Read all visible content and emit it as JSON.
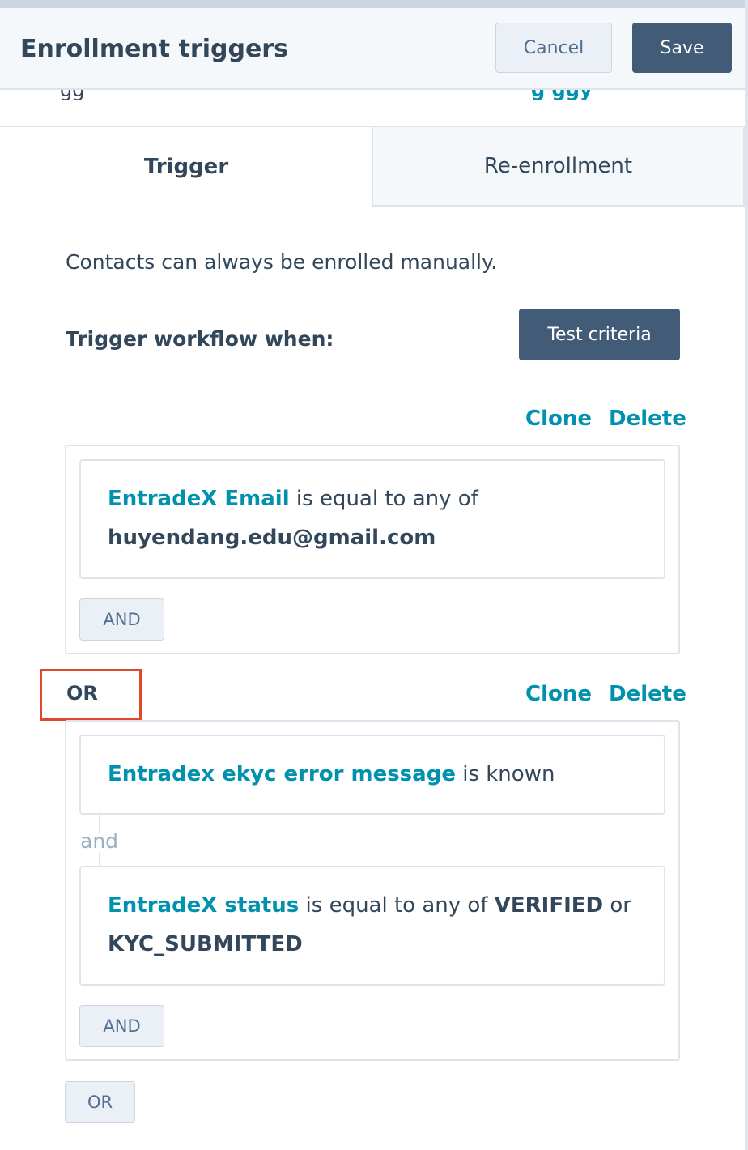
{
  "header": {
    "title": "Enrollment triggers",
    "cancel_label": "Cancel",
    "save_label": "Save"
  },
  "tabs": [
    {
      "label": "Trigger",
      "active": true
    },
    {
      "label": "Re-enrollment",
      "active": false
    }
  ],
  "info_text": "Contacts can always be enrolled manually.",
  "trigger_label": "Trigger workflow when:",
  "test_criteria_label": "Test criteria",
  "groups": [
    {
      "clone_label": "Clone",
      "delete_label": "Delete",
      "filters": [
        {
          "property": "EntradeX Email",
          "operator": "is equal to any of",
          "value": "huyendang.edu@gmail.com"
        }
      ],
      "and_button": "AND"
    },
    {
      "or_label": "OR",
      "clone_label": "Clone",
      "delete_label": "Delete",
      "filters": [
        {
          "property": "Entradex ekyc error message",
          "operator": "is known"
        },
        {
          "property": "EntradeX status",
          "operator": "is equal to any of",
          "value1": "VERIFIED",
          "joiner": "or",
          "value2": "KYC_SUBMITTED"
        }
      ],
      "connector_label": "and",
      "and_button": "AND"
    }
  ],
  "or_button": "OR",
  "colors": {
    "link": "#0091ae",
    "primary_button": "#425b76",
    "text": "#33475b",
    "highlight": "#e0472f"
  }
}
